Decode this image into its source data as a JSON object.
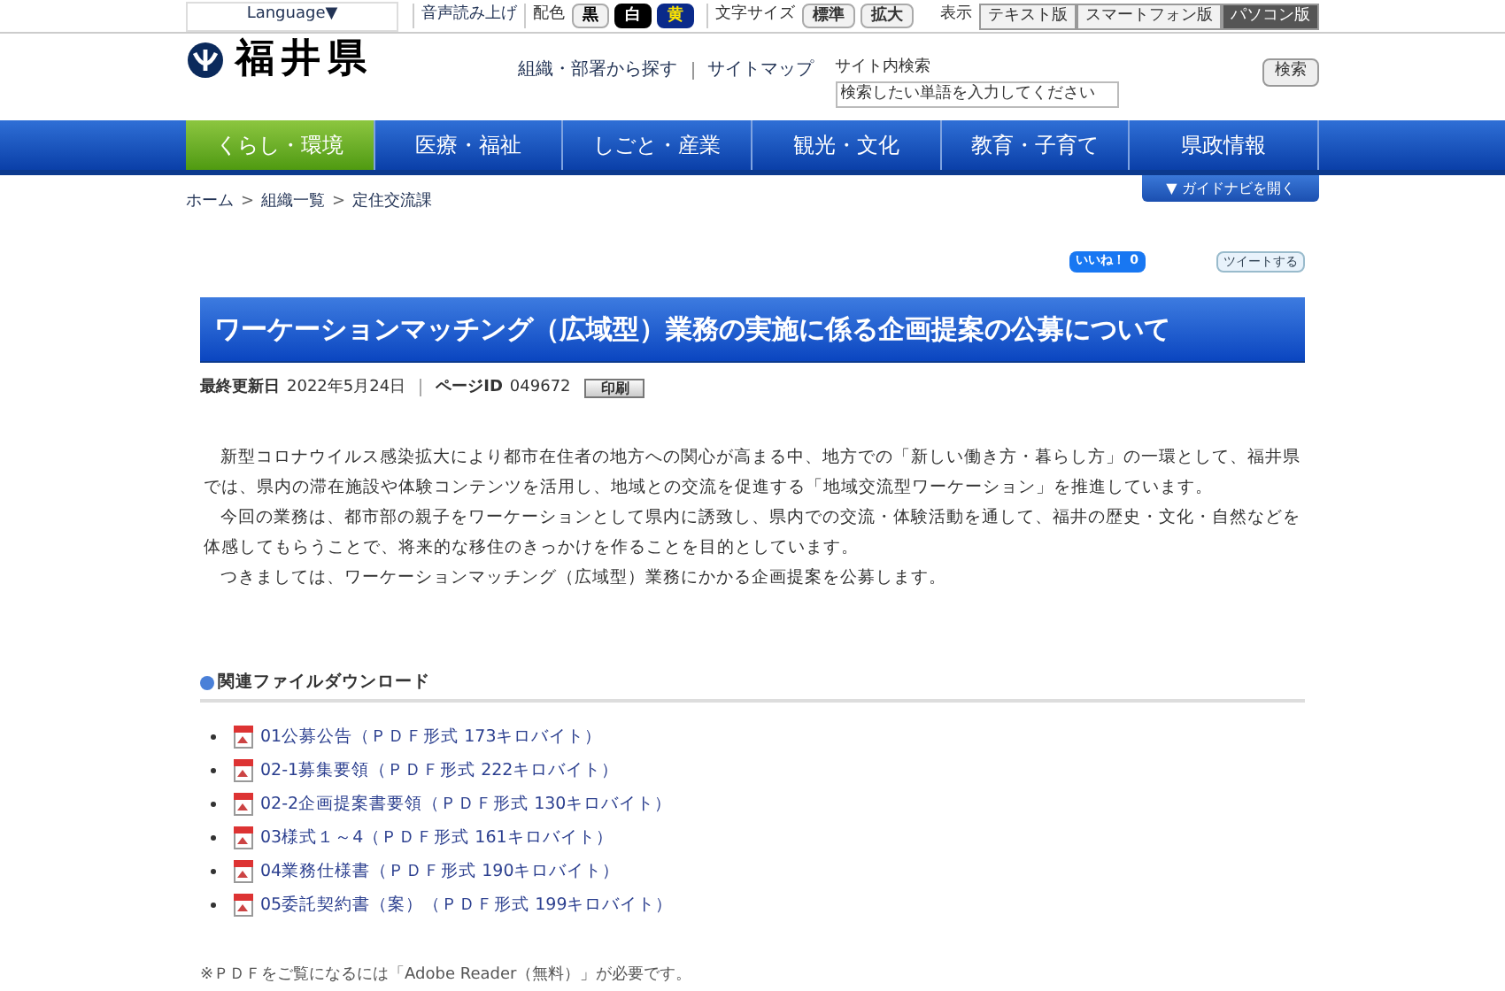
{
  "utility_bar": {
    "language": "Language▼",
    "read_aloud": "音声読み上げ",
    "color_label": "配色",
    "color_options": [
      {
        "label": "黒",
        "kind": "light"
      },
      {
        "label": "白",
        "kind": "dark"
      },
      {
        "label": "黄",
        "kind": "navy"
      }
    ],
    "text_size_label": "文字サイズ",
    "text_size_options": [
      "標準",
      "拡大"
    ],
    "display_label": "表示",
    "display_options": [
      {
        "label": "テキスト版",
        "selected": false
      },
      {
        "label": "スマートフォン版",
        "selected": false
      },
      {
        "label": "パソコン版",
        "selected": true
      }
    ]
  },
  "header": {
    "logo_text": "福井県",
    "links": [
      "組織・部署から探す",
      "サイトマップ"
    ],
    "search_label": "サイト内検索",
    "search_placeholder": "検索したい単語を入力してください",
    "search_button": "検索"
  },
  "nav_tabs": [
    {
      "label": "くらし・環境",
      "selected": true
    },
    {
      "label": "医療・福祉",
      "selected": false
    },
    {
      "label": "しごと・産業",
      "selected": false
    },
    {
      "label": "観光・文化",
      "selected": false
    },
    {
      "label": "教育・子育て",
      "selected": false
    },
    {
      "label": "県政情報",
      "selected": false
    }
  ],
  "breadcrumb": [
    "ホーム",
    "組織一覧",
    "定住交流課"
  ],
  "breadcrumb_separator": ">",
  "guide_button": "▼ ガイドナビを開く",
  "social": {
    "like": "いいね！ 0",
    "tweet": "ツイートする"
  },
  "title": "ワーケーションマッチング（広域型）業務の実施に係る企画提案の公募について",
  "meta": {
    "updated_label": "最終更新日",
    "updated": "2022年5月24日",
    "page_id_label": "ページID",
    "page_id": "049672",
    "print_button": "印刷"
  },
  "paragraphs": [
    "新型コロナウイルス感染拡大により都市在住者の地方への関心が高まる中、地方での「新しい働き方・暮らし方」の一環として、福井県では、県内の滞在施設や体験コンテンツを活用し、地域との交流を促進する「地域交流型ワーケーション」を推進しています。",
    "今回の業務は、都市部の親子をワーケーションとして県内に誘致し、県内での交流・体験活動を通して、福井の歴史・文化・自然などを体感してもらうことで、将来的な移住のきっかけを作ることを目的としています。",
    "つきましては、ワーケーションマッチング（広域型）業務にかかる企画提案を公募します。"
  ],
  "downloads": {
    "heading": "関連ファイルダウンロード",
    "files": [
      "01公募公告（ＰＤＦ形式 173キロバイト）",
      "02-1募集要領（ＰＤＦ形式 222キロバイト）",
      "02-2企画提案書要領（ＰＤＦ形式 130キロバイト）",
      "03様式１～4（ＰＤＦ形式 161キロバイト）",
      "04業務仕様書（ＰＤＦ形式 190キロバイト）",
      "05委託契約書（案）（ＰＤＦ形式 199キロバイト）"
    ]
  },
  "note": "※ＰＤＦをご覧になるには「Adobe Reader（無料）」が必要です。"
}
